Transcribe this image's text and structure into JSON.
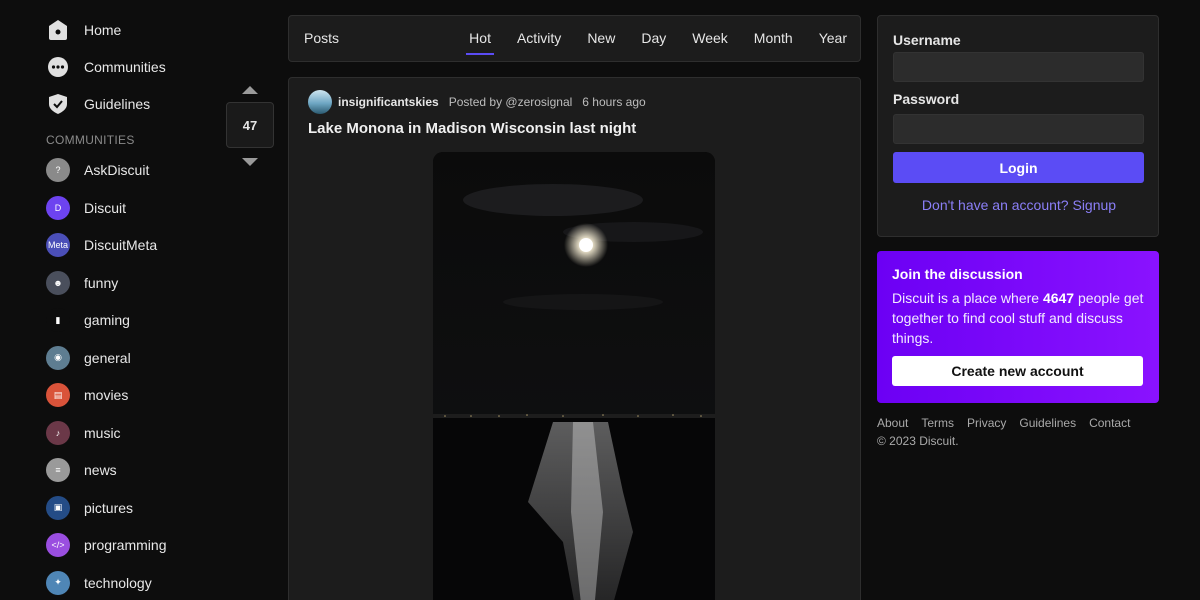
{
  "sidebar": {
    "nav": [
      {
        "label": "Home",
        "icon": "home-icon"
      },
      {
        "label": "Communities",
        "icon": "communities-icon"
      },
      {
        "label": "Guidelines",
        "icon": "shield-icon"
      }
    ],
    "section_label": "COMMUNITIES",
    "communities": [
      {
        "label": "AskDiscuit",
        "icon": "askdiscuit-icon",
        "color": "#8a8a8a",
        "glyph": "?"
      },
      {
        "label": "Discuit",
        "icon": "discuit-icon",
        "color": "#6d43f0",
        "glyph": "D"
      },
      {
        "label": "DiscuitMeta",
        "icon": "discuitmeta-icon",
        "color": "#4b4fb8",
        "glyph": "Meta"
      },
      {
        "label": "funny",
        "icon": "funny-icon",
        "color": "#4a4f5c",
        "glyph": "☻"
      },
      {
        "label": "gaming",
        "icon": "gaming-icon",
        "color": "#0d0d0d",
        "glyph": "▮"
      },
      {
        "label": "general",
        "icon": "general-icon",
        "color": "#5e7d91",
        "glyph": "◉"
      },
      {
        "label": "movies",
        "icon": "movies-icon",
        "color": "#d9533a",
        "glyph": "▤"
      },
      {
        "label": "music",
        "icon": "music-icon",
        "color": "#6b3848",
        "glyph": "♪"
      },
      {
        "label": "news",
        "icon": "news-icon",
        "color": "#9a9a9a",
        "glyph": "≡"
      },
      {
        "label": "pictures",
        "icon": "pictures-icon",
        "color": "#244c86",
        "glyph": "▣"
      },
      {
        "label": "programming",
        "icon": "programming-icon",
        "color": "#9a4ee0",
        "glyph": "</>"
      },
      {
        "label": "technology",
        "icon": "technology-icon",
        "color": "#4f86b6",
        "glyph": "✦"
      }
    ]
  },
  "vote": {
    "count": "47"
  },
  "feed": {
    "title": "Posts",
    "tabs": [
      "Hot",
      "Activity",
      "New",
      "Day",
      "Week",
      "Month",
      "Year"
    ],
    "active_tab": "Hot"
  },
  "post": {
    "community": "insignificantskies",
    "posted_by": "Posted by @zerosignal",
    "time_ago": "6 hours ago",
    "title": "Lake Monona in Madison Wisconsin last night"
  },
  "login": {
    "username_label": "Username",
    "password_label": "Password",
    "username_value": "",
    "password_value": "",
    "button": "Login",
    "signup_link": "Don't have an account? Signup"
  },
  "join": {
    "title": "Join the discussion",
    "text_before": "Discuit is a place where ",
    "user_count": "4647",
    "text_after": " people get together to find cool stuff and discuss things.",
    "button": "Create new account"
  },
  "footer": {
    "links": [
      "About",
      "Terms",
      "Privacy",
      "Guidelines",
      "Contact"
    ],
    "copyright": "© 2023 Discuit."
  },
  "colors": {
    "accent": "#5b4cf5",
    "join_gradient_start": "#6c00f4",
    "join_gradient_end": "#8a12ff",
    "background": "#0d0d0d",
    "card": "#1c1c1c"
  }
}
